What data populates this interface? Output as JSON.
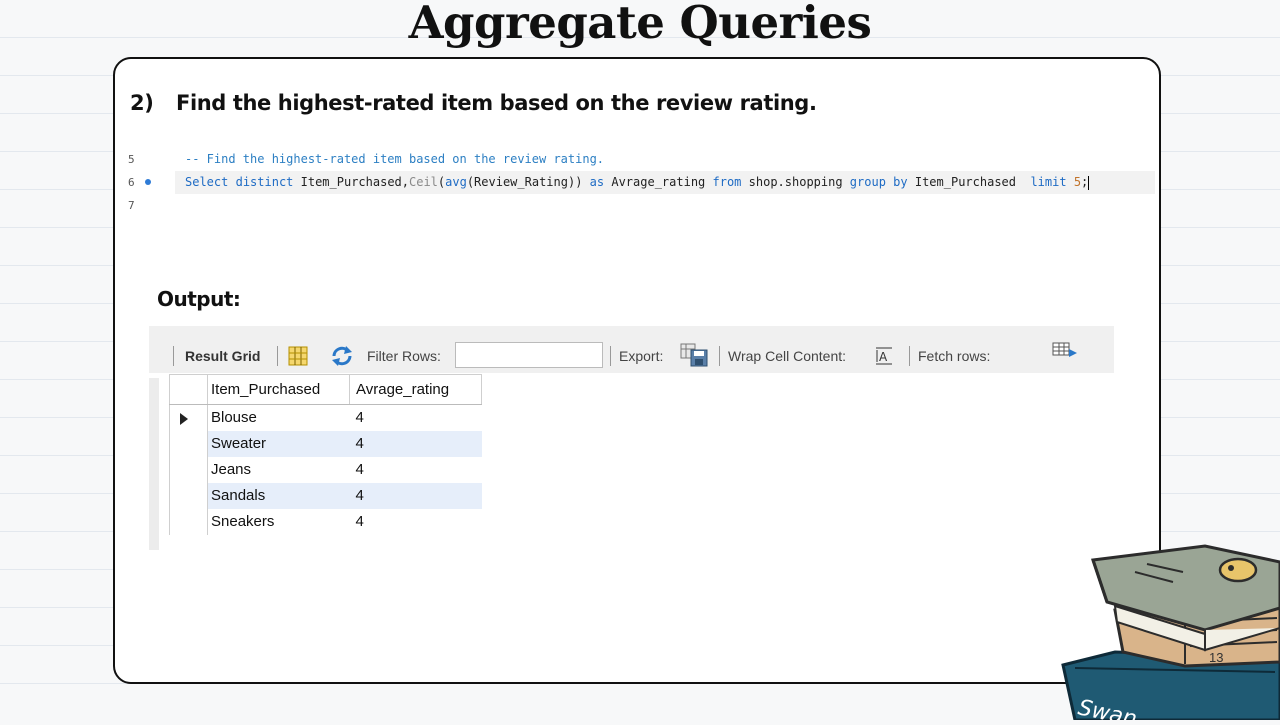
{
  "slide": {
    "title": "Aggregate Queries",
    "question_number": "2)",
    "question_text": "Find the highest-rated item based on the review rating.",
    "output_label": "Output:",
    "page_number": "13",
    "logo_text": "Swan"
  },
  "editor": {
    "lines": [
      {
        "number": "5",
        "comment": "-- Find the highest-rated item based on the review rating."
      },
      {
        "number": "6",
        "tokens": {
          "kw_select": "Select",
          "kw_distinct": "distinct",
          "ident1": "Item_Purchased,",
          "fn_ceil": "Ceil",
          "paren_open": "(",
          "fn_avg": "avg",
          "arg": "(Review_Rating))",
          "kw_as": "as",
          "alias": "Avrage_rating",
          "kw_from": "from",
          "table": "shop.shopping",
          "kw_group": "group",
          "kw_by": "by",
          "ident2": "Item_Purchased",
          "kw_limit": "limit",
          "num": "5",
          "semi": ";"
        }
      },
      {
        "number": "7"
      }
    ]
  },
  "toolbar": {
    "result_grid": "Result Grid",
    "filter_rows": "Filter Rows:",
    "export": "Export:",
    "wrap_cell": "Wrap Cell Content:",
    "fetch_rows": "Fetch rows:"
  },
  "grid": {
    "columns": [
      "Item_Purchased",
      "Avrage_rating"
    ],
    "rows": [
      [
        "Blouse",
        "4"
      ],
      [
        "Sweater",
        "4"
      ],
      [
        "Jeans",
        "4"
      ],
      [
        "Sandals",
        "4"
      ],
      [
        "Sneakers",
        "4"
      ]
    ]
  },
  "colors": {
    "keyword": "#1e6bc4",
    "comment": "#2c7fc3",
    "selected_row": "#e6eefa",
    "book_teal": "#1f5a73"
  }
}
